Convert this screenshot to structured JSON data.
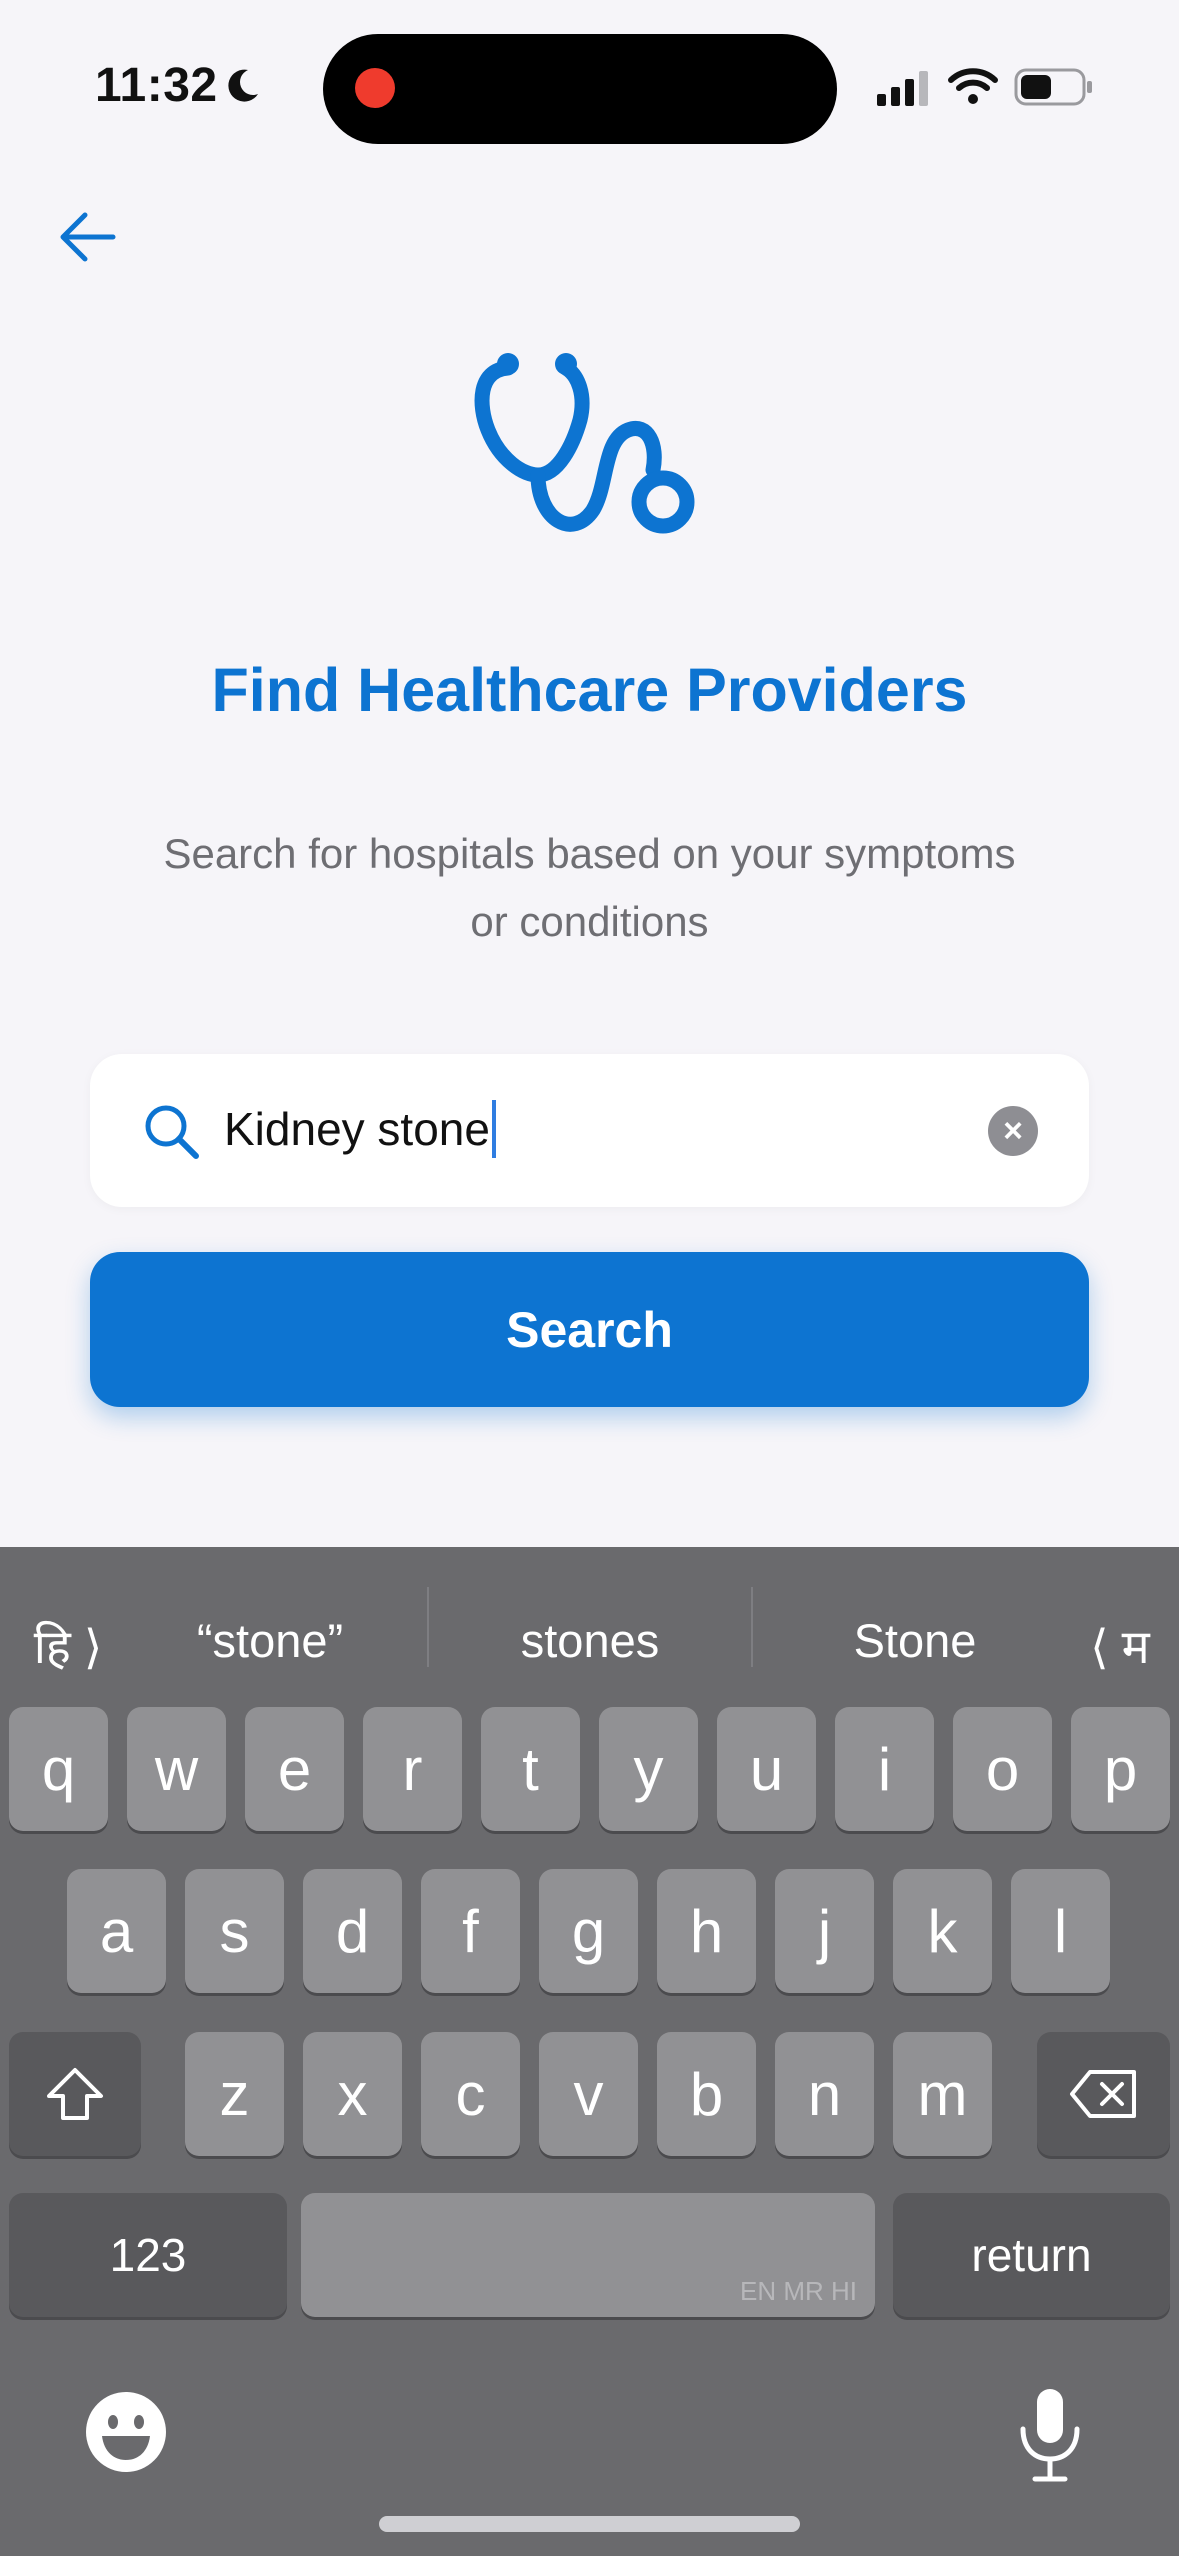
{
  "status_bar": {
    "time": "11:32"
  },
  "header": {
    "back_icon": "arrow-left-icon"
  },
  "hero": {
    "icon": "stethoscope-icon",
    "title": "Find Healthcare Providers",
    "subtitle_line1": "Search for hospitals based on your symptoms",
    "subtitle_line2": "or conditions"
  },
  "search": {
    "value": "Kidney stone",
    "clear_symbol": "×",
    "button_label": "Search"
  },
  "keyboard": {
    "left_switch": "हि ⟩",
    "right_switch": "⟨ म",
    "suggestions": [
      "“stone”",
      "stones",
      "Stone"
    ],
    "row1": [
      "q",
      "w",
      "e",
      "r",
      "t",
      "y",
      "u",
      "i",
      "o",
      "p"
    ],
    "row2": [
      "a",
      "s",
      "d",
      "f",
      "g",
      "h",
      "j",
      "k",
      "l"
    ],
    "row3": [
      "z",
      "x",
      "c",
      "v",
      "b",
      "n",
      "m"
    ],
    "numbers_label": "123",
    "space_hint": "EN MR HI",
    "return_label": "return"
  },
  "colors": {
    "accent": "#0d74d1",
    "background": "#f6f5f9",
    "keyboard_bg": "#6a6a6d"
  }
}
